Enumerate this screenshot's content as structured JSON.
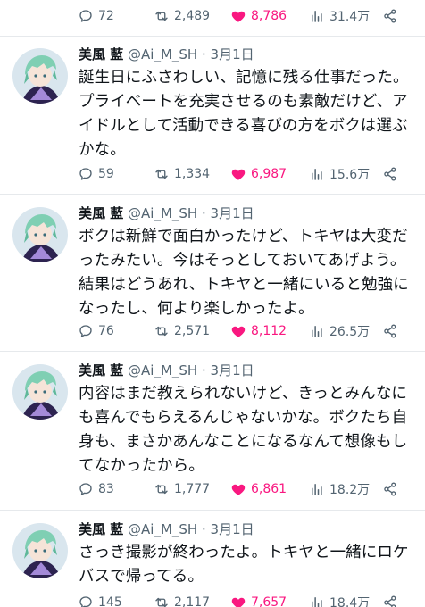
{
  "top_actions": {
    "replies": "72",
    "retweets": "2,489",
    "likes": "8,786",
    "views": "31.4万"
  },
  "tweets": [
    {
      "name": "美風 藍",
      "handle": "@Ai_M_SH",
      "sep": "·",
      "date": "3月1日",
      "text": "誕生日にふさわしい、記憶に残る仕事だった。プライベートを充実させるのも素敵だけど、アイドルとして活動できる喜びの方をボクは選ぶかな。",
      "replies": "59",
      "retweets": "1,334",
      "likes": "6,987",
      "views": "15.6万"
    },
    {
      "name": "美風 藍",
      "handle": "@Ai_M_SH",
      "sep": "·",
      "date": "3月1日",
      "text": "ボクは新鮮で面白かったけど、トキヤは大変だったみたい。今はそっとしておいてあげよう。結果はどうあれ、トキヤと一緒にいると勉強になったし、何より楽しかったよ。",
      "replies": "76",
      "retweets": "2,571",
      "likes": "8,112",
      "views": "26.5万"
    },
    {
      "name": "美風 藍",
      "handle": "@Ai_M_SH",
      "sep": "·",
      "date": "3月1日",
      "text": "内容はまだ教えられないけど、きっとみんなにも喜んでもらえるんじゃないかな。ボクたち自身も、まさかあんなことになるなんて想像もしてなかったから。",
      "replies": "83",
      "retweets": "1,777",
      "likes": "6,861",
      "views": "18.2万"
    },
    {
      "name": "美風 藍",
      "handle": "@Ai_M_SH",
      "sep": "·",
      "date": "3月1日",
      "text": "さっき撮影が終わったよ。トキヤと一緒にロケバスで帰ってる。",
      "replies": "145",
      "retweets": "2,117",
      "likes": "7,657",
      "views": "18.4万"
    }
  ],
  "colors": {
    "like": "#f91880",
    "muted": "#536471",
    "text": "#0f1419",
    "divider": "#e6e9ec"
  }
}
